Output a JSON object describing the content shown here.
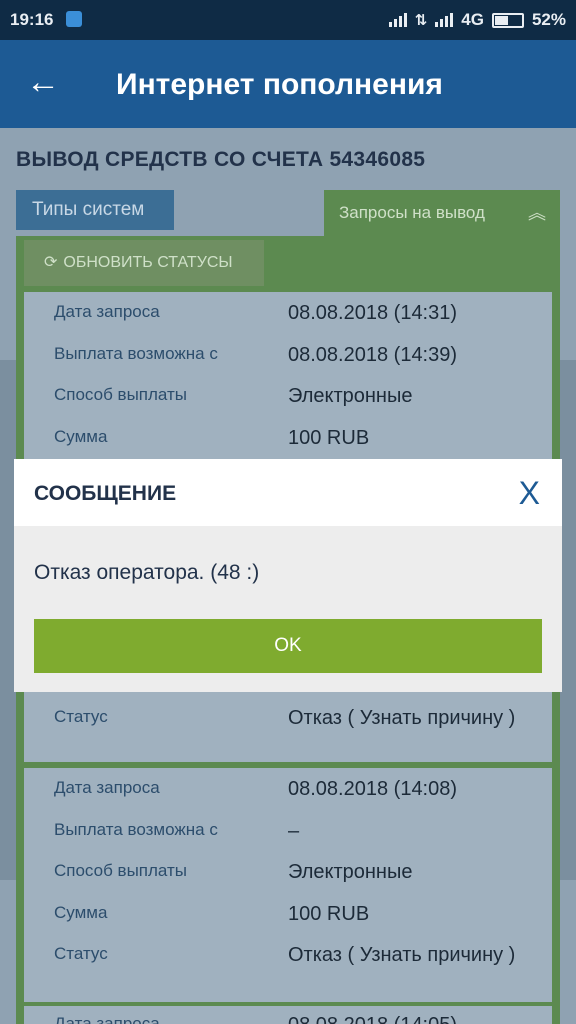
{
  "status_bar": {
    "time": "19:16",
    "network": "4G",
    "battery": "52%",
    "battery_level": 0.52
  },
  "app_bar": {
    "title": "Интернет пополнения"
  },
  "page": {
    "heading": "ВЫВОД СРЕДСТВ СО СЧЕТА 54346085",
    "types_button": "Типы систем",
    "requests_tab": "Запросы на вывод",
    "refresh_button": "ОБНОВИТЬ СТАТУСЫ"
  },
  "labels": {
    "date": "Дата запроса",
    "payout": "Выплата возможна с",
    "method": "Способ выплаты",
    "amount": "Сумма",
    "status": "Статус"
  },
  "requests": [
    {
      "date": "08.08.2018 (14:31)",
      "payout": "08.08.2018 (14:39)",
      "method": "Электронные",
      "amount": "100 RUB",
      "status": "Отказ ( Узнать причину )"
    },
    {
      "date": "08.08.2018 (14:08)",
      "payout": "–",
      "method": "Электронные",
      "amount": "100 RUB",
      "status": "Отказ ( Узнать причину )"
    },
    {
      "date": "08.08.2018 (14:05)"
    }
  ],
  "dialog": {
    "title": "СООБЩЕНИЕ",
    "close": "X",
    "message": "Отказ оператора. (48 :)",
    "ok": "OK"
  }
}
